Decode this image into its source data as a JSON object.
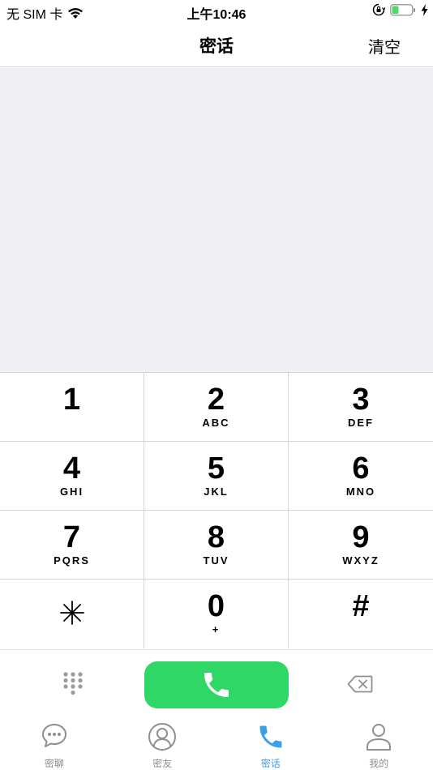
{
  "status": {
    "carrier": "无 SIM 卡",
    "time": "上午10:46"
  },
  "nav": {
    "title": "密话",
    "clear_label": "清空"
  },
  "display": {
    "number": ""
  },
  "keys": [
    {
      "digit": "1",
      "letters": ""
    },
    {
      "digit": "2",
      "letters": "ABC"
    },
    {
      "digit": "3",
      "letters": "DEF"
    },
    {
      "digit": "4",
      "letters": "GHI"
    },
    {
      "digit": "5",
      "letters": "JKL"
    },
    {
      "digit": "6",
      "letters": "MNO"
    },
    {
      "digit": "7",
      "letters": "PQRS"
    },
    {
      "digit": "8",
      "letters": "TUV"
    },
    {
      "digit": "9",
      "letters": "WXYZ"
    },
    {
      "digit": "",
      "letters": "",
      "icon": "asterisk-icon"
    },
    {
      "digit": "0",
      "letters": "+"
    },
    {
      "digit": "#",
      "letters": ""
    }
  ],
  "actions": {
    "dialpad_icon": "dialpad-grid-icon",
    "call_icon": "phone-icon",
    "backspace_icon": "backspace-icon"
  },
  "tabs": [
    {
      "label": "密聊",
      "icon": "chat-bubble-icon",
      "active": false
    },
    {
      "label": "密友",
      "icon": "contacts-icon",
      "active": false
    },
    {
      "label": "密话",
      "icon": "phone-icon",
      "active": true
    },
    {
      "label": "我的",
      "icon": "profile-icon",
      "active": false
    }
  ],
  "colors": {
    "accent": "#3d9fe8",
    "call_green": "#2fd866",
    "display_bg": "#efeff4",
    "inactive_tab": "#8e8e93",
    "battery_green": "#4cd964"
  }
}
